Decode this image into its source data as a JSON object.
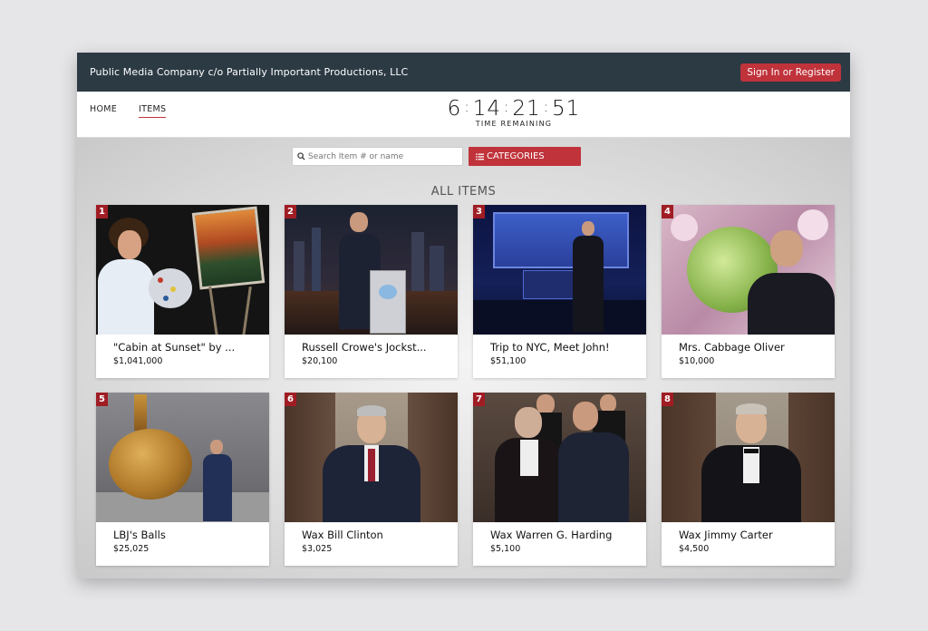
{
  "header": {
    "org_name": "Public Media Company c/o Partially Important Productions, LLC",
    "signin_label": "Sign In or Register"
  },
  "nav": {
    "home_label": "HOME",
    "items_label": "ITEMS"
  },
  "timer": {
    "days": "6",
    "hours": "14",
    "minutes": "21",
    "seconds": "51",
    "label": "TIME REMAINING"
  },
  "search": {
    "placeholder": "Search Item # or name",
    "categories_label": "CATEGORIES"
  },
  "section_title": "ALL ITEMS",
  "colors": {
    "topbar": "#2c3a44",
    "accent": "#c0333b",
    "badge": "#a01d24"
  },
  "items": [
    {
      "number": "1",
      "title": "\"Cabin at Sunset\" by ...",
      "price": "$1,041,000",
      "image": "painter-with-easel"
    },
    {
      "number": "2",
      "title": "Russell Crowe's Jockst...",
      "price": "$20,100",
      "image": "host-with-jockstrap-display"
    },
    {
      "number": "3",
      "title": "Trip to NYC, Meet John!",
      "price": "$51,100",
      "image": "host-on-stage"
    },
    {
      "number": "4",
      "title": "Mrs. Cabbage Oliver",
      "price": "$10,000",
      "image": "host-kissing-cabbage"
    },
    {
      "number": "5",
      "title": "LBJ's Balls",
      "price": "$25,025",
      "image": "bronze-sculpture"
    },
    {
      "number": "6",
      "title": "Wax Bill Clinton",
      "price": "$3,025",
      "image": "wax-figure"
    },
    {
      "number": "7",
      "title": "Wax Warren G. Harding",
      "price": "$5,100",
      "image": "wax-figure-with-host"
    },
    {
      "number": "8",
      "title": "Wax Jimmy Carter",
      "price": "$4,500",
      "image": "wax-figure"
    }
  ]
}
